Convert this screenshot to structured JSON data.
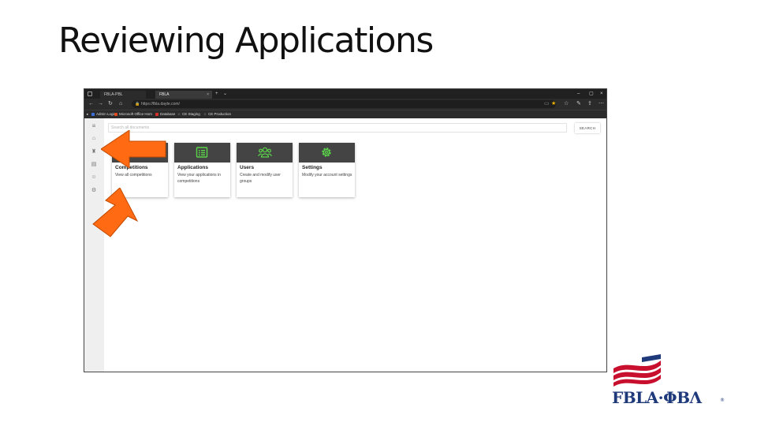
{
  "slide": {
    "title": "Reviewing Applications"
  },
  "browser": {
    "tabs": [
      {
        "label": "FBLA-PBL",
        "active": false
      },
      {
        "label": "FBLA",
        "active": true
      }
    ],
    "tab_close": "×",
    "new_tab": "+",
    "tab_menu": "⌄",
    "window_controls": {
      "minimize": "–",
      "maximize": "▢",
      "close": "×"
    },
    "url": "https://fbla.dayte.com/",
    "bookmarks": [
      {
        "label": "Admin Login",
        "color": "#3a6fd8"
      },
      {
        "label": "Microsoft Office Hom",
        "color": "#e04a1f"
      },
      {
        "label": "Database",
        "color": "#d93025"
      },
      {
        "label": "CE Staging",
        "color": "#bbbbbb"
      },
      {
        "label": "CE Production",
        "color": "#bbbbbb"
      }
    ]
  },
  "app": {
    "search": {
      "placeholder": "Search all documents"
    },
    "search_button": "SEARCH",
    "cards": [
      {
        "title": "Competitions",
        "desc": "View all competitions",
        "icon": "trophy-icon"
      },
      {
        "title": "Applications",
        "desc": "View your applications in competitions",
        "icon": "list-icon"
      },
      {
        "title": "Users",
        "desc": "Create and modify user groups",
        "icon": "users-icon"
      },
      {
        "title": "Settings",
        "desc": "Modify your account settings",
        "icon": "gear-icon"
      }
    ]
  },
  "colors": {
    "arrow": "#ff6a13",
    "card_header": "#444444",
    "icon_green": "#5bd44a",
    "logo_red": "#c8102e",
    "logo_blue": "#1f3a7a"
  }
}
